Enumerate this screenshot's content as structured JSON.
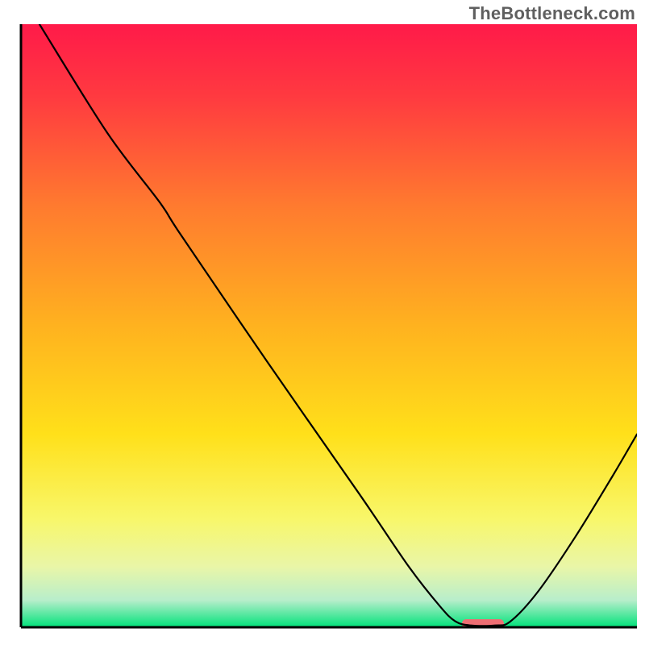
{
  "watermark": "TheBottleneck.com",
  "chart_data": {
    "type": "line",
    "title": "",
    "xlabel": "",
    "ylabel": "",
    "xlim": [
      0,
      100
    ],
    "ylim": [
      0,
      100
    ],
    "grid": false,
    "legend": false,
    "background_gradient_stops": [
      {
        "offset": 0.0,
        "color": "#ff1a49"
      },
      {
        "offset": 0.12,
        "color": "#ff3a40"
      },
      {
        "offset": 0.3,
        "color": "#ff7a2f"
      },
      {
        "offset": 0.5,
        "color": "#ffb21f"
      },
      {
        "offset": 0.68,
        "color": "#ffe01a"
      },
      {
        "offset": 0.82,
        "color": "#f8f76a"
      },
      {
        "offset": 0.9,
        "color": "#e9f6a8"
      },
      {
        "offset": 0.955,
        "color": "#b8eecb"
      },
      {
        "offset": 1.0,
        "color": "#00e27a"
      }
    ],
    "curve_points": [
      {
        "x": 3.0,
        "y": 100.0
      },
      {
        "x": 14.0,
        "y": 82.0
      },
      {
        "x": 22.5,
        "y": 70.5
      },
      {
        "x": 26.0,
        "y": 65.0
      },
      {
        "x": 40.0,
        "y": 44.0
      },
      {
        "x": 55.0,
        "y": 22.0
      },
      {
        "x": 63.0,
        "y": 10.0
      },
      {
        "x": 68.0,
        "y": 3.5
      },
      {
        "x": 70.5,
        "y": 1.0
      },
      {
        "x": 73.0,
        "y": 0.3
      },
      {
        "x": 77.0,
        "y": 0.3
      },
      {
        "x": 79.5,
        "y": 1.0
      },
      {
        "x": 84.0,
        "y": 6.0
      },
      {
        "x": 90.0,
        "y": 15.0
      },
      {
        "x": 96.0,
        "y": 25.0
      },
      {
        "x": 100.0,
        "y": 32.0
      }
    ],
    "marker": {
      "x_center": 75.0,
      "x_halfwidth": 3.4,
      "y": 0.5,
      "color": "#ee6e73",
      "height_pct": 1.2
    },
    "axis": {
      "stroke": "#000000",
      "stroke_width": 3
    },
    "curve_style": {
      "stroke": "#000000",
      "stroke_width": 2.2
    }
  }
}
